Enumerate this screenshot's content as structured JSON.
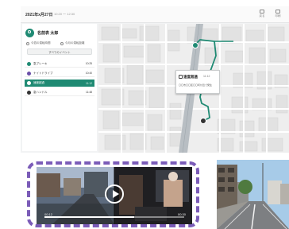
{
  "header": {
    "date": "2021年x月27日",
    "time_range": "10:20 〜 12:30",
    "actions": [
      "戻る",
      "印刷"
    ]
  },
  "driver": {
    "name": "名前表 太郎",
    "meta_left": "今週の運転時間",
    "meta_right": "今月の運転距離"
  },
  "mode_button": "すべてのイベント",
  "events": [
    {
      "label": "急ブレーキ",
      "time": "10:25",
      "color": "#1f8a73",
      "active": false
    },
    {
      "label": "ナイトドライブ",
      "time": "10:40",
      "color": "#6a4fa8",
      "active": false
    },
    {
      "label": "速度超過",
      "time": "11:12",
      "color": "#1f8a73",
      "active": true
    },
    {
      "label": "急ハンドル",
      "time": "11:48",
      "color": "#333333",
      "active": false
    }
  ],
  "map": {
    "popup_title": "速度超過",
    "popup_time": "11:12",
    "popup_sub": "〇〇市〇〇区〇〇町付近で発生"
  },
  "video": {
    "current": "00:12",
    "total": "00:30",
    "progress": 0.64
  },
  "colors": {
    "accent": "#1f8a73",
    "highlight_border": "#7b5cb8",
    "road": "#b8bec3"
  }
}
